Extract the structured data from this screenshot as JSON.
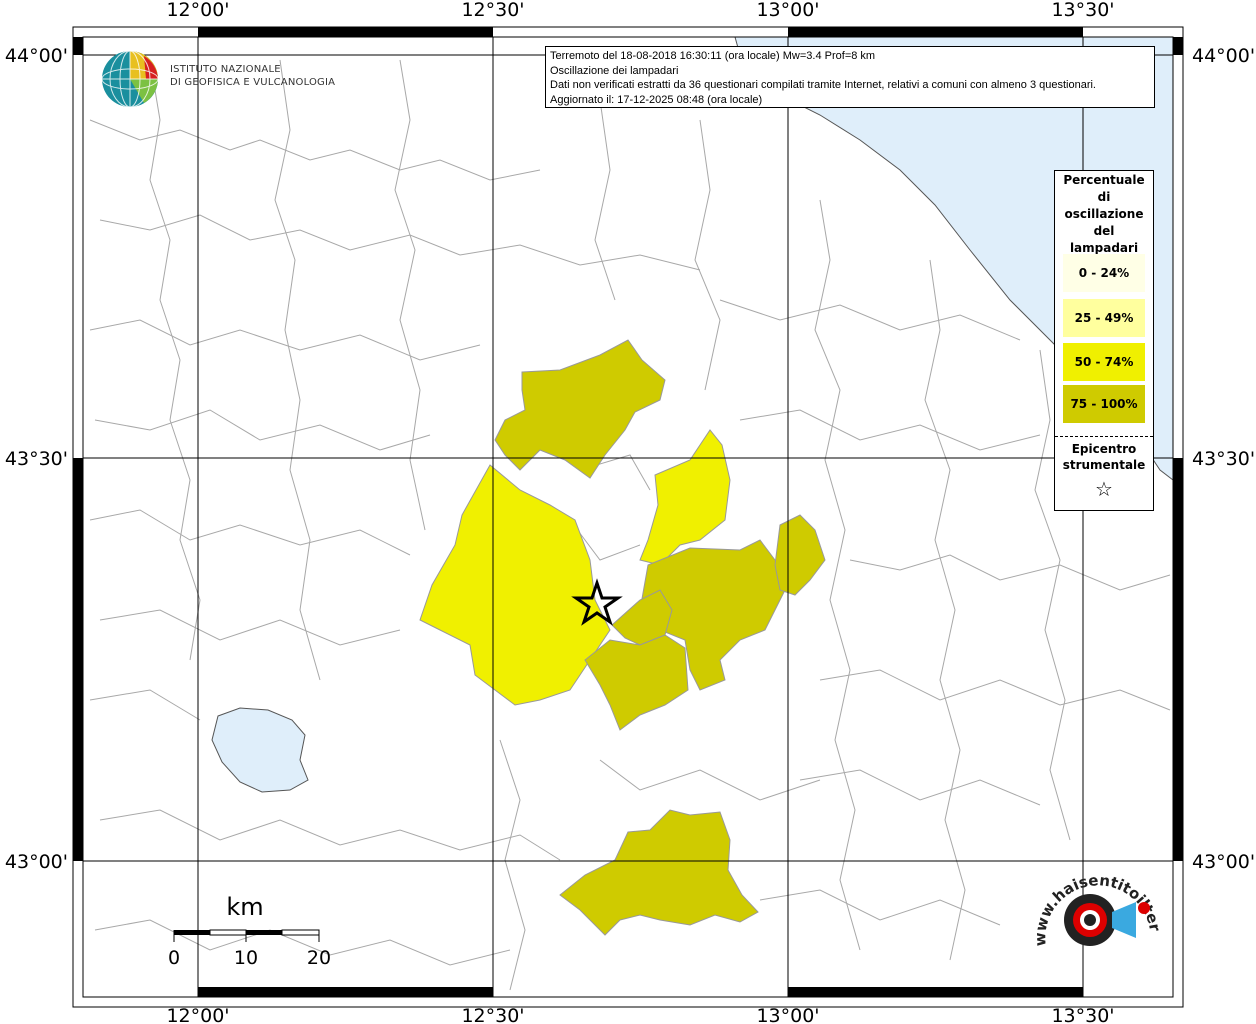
{
  "map": {
    "lon_labels": [
      "12°00'",
      "12°30'",
      "13°00'",
      "13°30'"
    ],
    "lat_labels": [
      "44°00'",
      "43°30'",
      "43°00'"
    ],
    "colors": {
      "sea": "#dfeefa",
      "land": "#ffffff",
      "border": "#a8a8a8",
      "class_0_24": "#ffffe6",
      "class_25_49": "#ffff9e",
      "class_50_74": "#f0f000",
      "class_75_100": "#cfcb00"
    }
  },
  "info": {
    "line1": "Terremoto del 18-08-2018 16:30:11 (ora locale) Mw=3.4 Prof=8 km",
    "line2": "Oscillazione dei lampadari",
    "line3": "Dati non verificati estratti da 36 questionari compilati tramite Internet, relativi a comuni con almeno 3 questionari.",
    "line4": "Aggiornato il: 17-12-2025 08:48 (ora locale)"
  },
  "legend": {
    "title": [
      "Percentuale",
      "di",
      "oscillazione",
      "del",
      "lampadari"
    ],
    "items": [
      {
        "label": "0 - 24%",
        "color": "#ffffe6"
      },
      {
        "label": "25 - 49%",
        "color": "#ffff9e"
      },
      {
        "label": "50 - 74%",
        "color": "#f0f000"
      },
      {
        "label": "75 - 100%",
        "color": "#cfcb00"
      }
    ],
    "epicenter_label": [
      "Epicentro",
      "strumentale"
    ],
    "epicenter_symbol": "☆"
  },
  "scale": {
    "unit": "km",
    "ticks": [
      "0",
      "10",
      "20"
    ]
  },
  "logos": {
    "ingv_line1": "ISTITUTO NAZIONALE",
    "ingv_line2": "DI GEOFISICA E VULCANOLOGIA",
    "hst_text": "www.haisentitoilterremoto.it"
  }
}
